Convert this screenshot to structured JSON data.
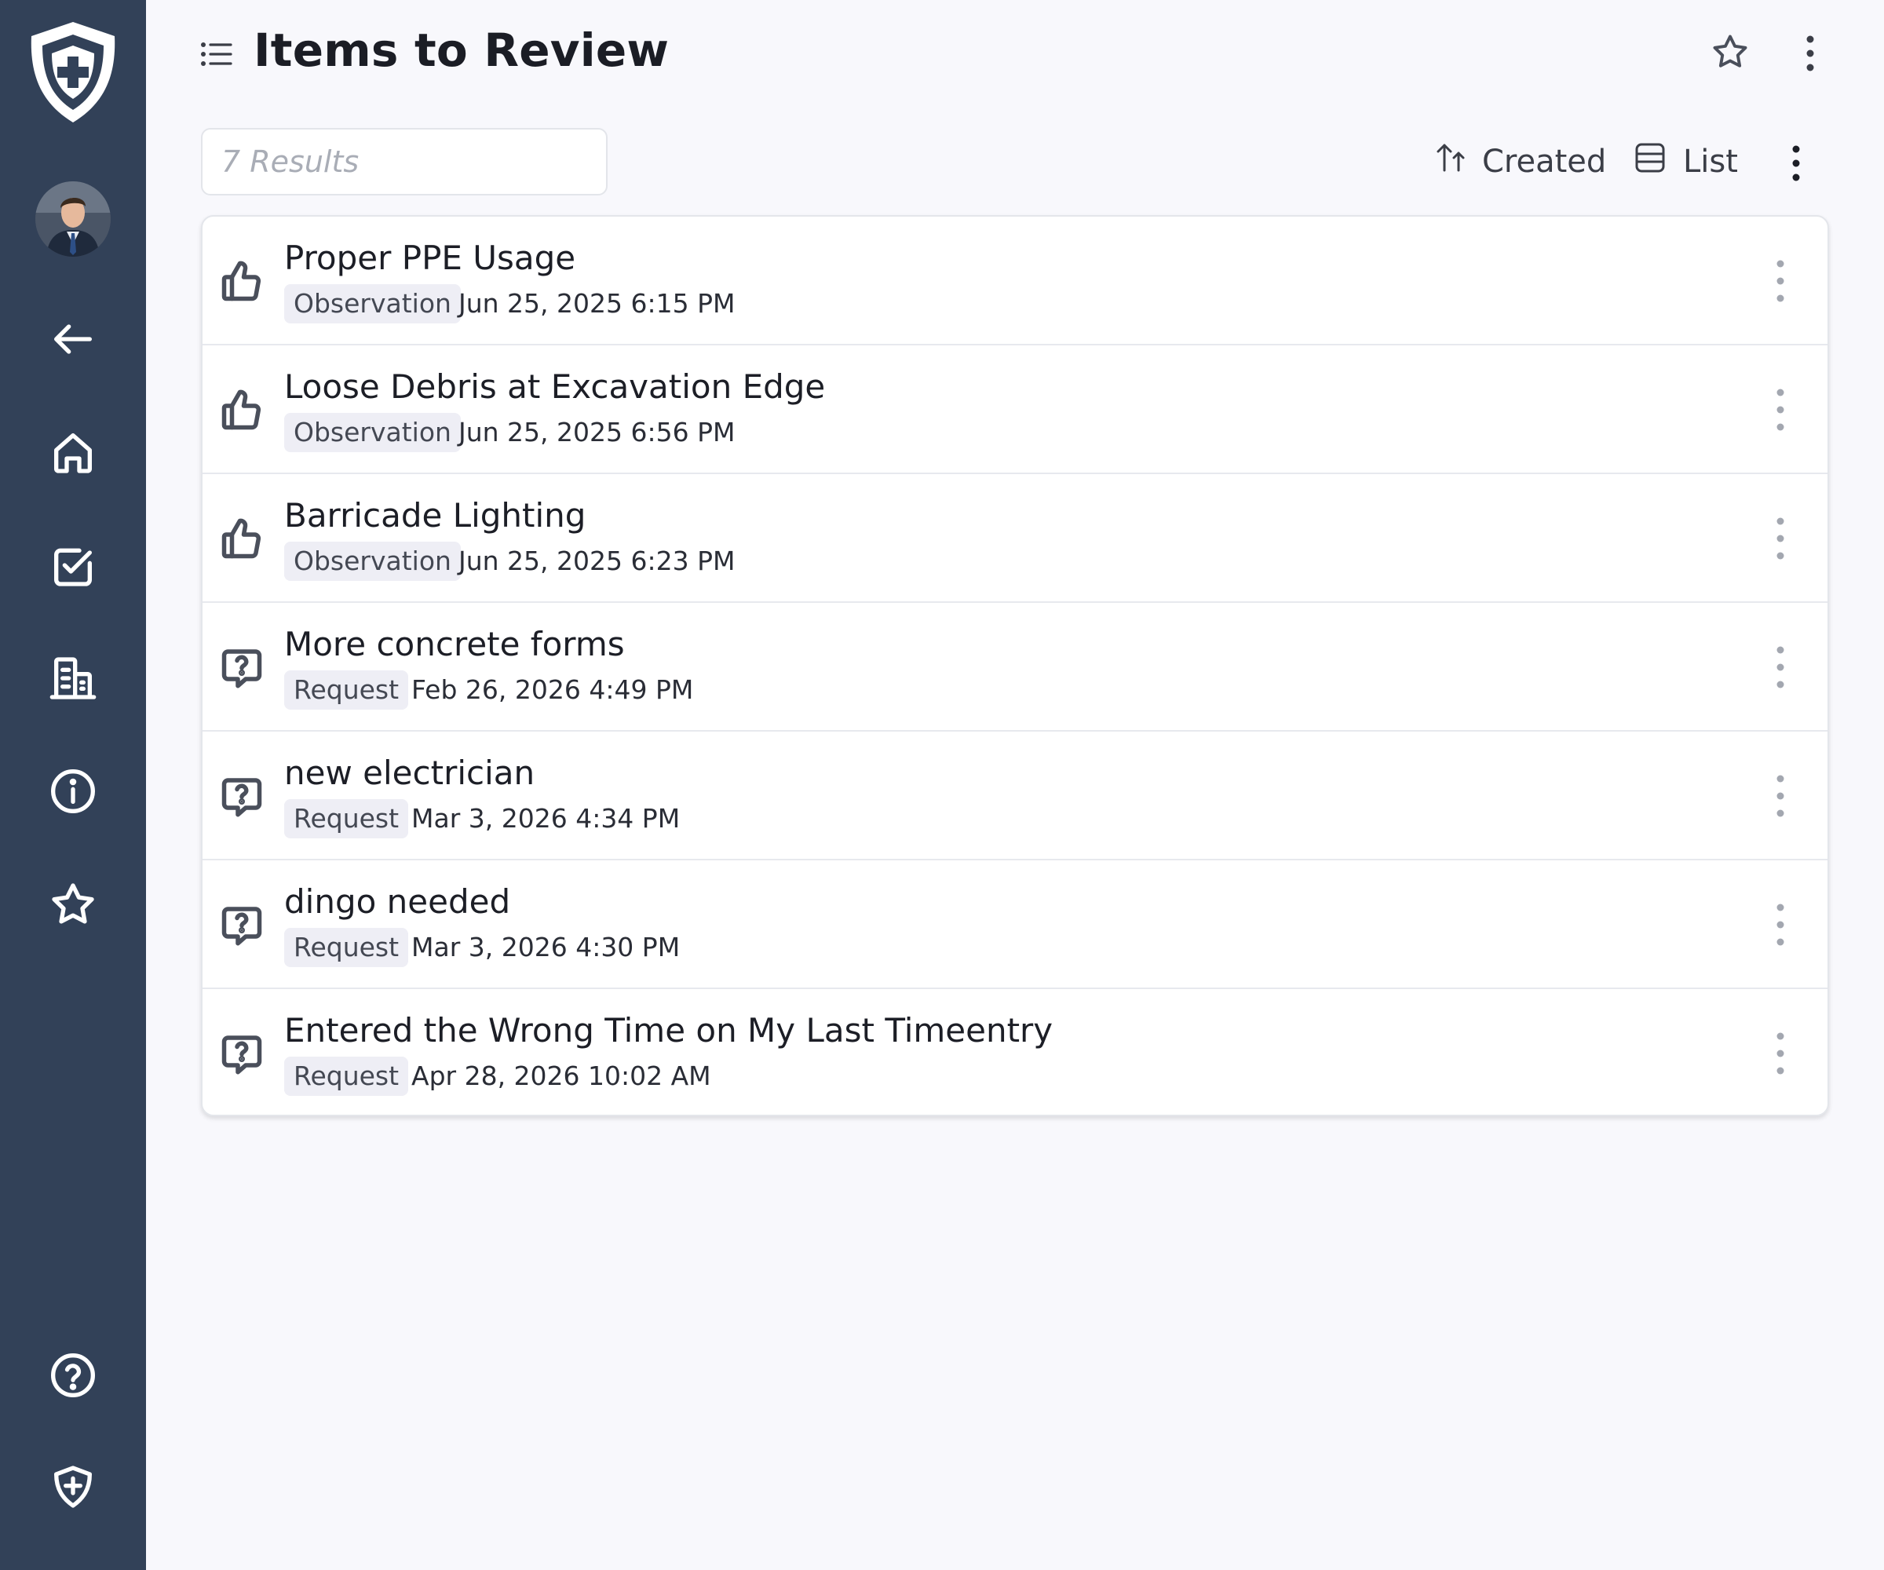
{
  "sidebar": {
    "logo": "shield-plus-logo",
    "avatar": "user-avatar",
    "items": [
      {
        "icon": "arrow-left-icon"
      },
      {
        "icon": "home-icon"
      },
      {
        "icon": "checkbox-icon"
      },
      {
        "icon": "building-icon"
      },
      {
        "icon": "info-icon"
      },
      {
        "icon": "star-icon"
      }
    ],
    "bottom_items": [
      {
        "icon": "help-circle-icon"
      },
      {
        "icon": "shield-icon"
      }
    ]
  },
  "header": {
    "title": "Items to Review"
  },
  "toolbar": {
    "search_placeholder": "7 Results",
    "sort_label": "Created",
    "view_label": "List"
  },
  "items": [
    {
      "icon": "thumbs-up-icon",
      "title": "Proper PPE Usage",
      "type": "Observation",
      "date": "Jun 25, 2025 6:15 PM"
    },
    {
      "icon": "thumbs-up-icon",
      "title": "Loose Debris at Excavation Edge",
      "type": "Observation",
      "date": "Jun 25, 2025 6:56 PM"
    },
    {
      "icon": "thumbs-up-icon",
      "title": "Barricade Lighting",
      "type": "Observation",
      "date": "Jun 25, 2025 6:23 PM"
    },
    {
      "icon": "question-bubble-icon",
      "title": "More concrete forms",
      "type": "Request",
      "date": "Feb 26, 2026 4:49 PM"
    },
    {
      "icon": "question-bubble-icon",
      "title": "new electrician",
      "type": "Request",
      "date": "Mar 3, 2026 4:34 PM"
    },
    {
      "icon": "question-bubble-icon",
      "title": "dingo needed",
      "type": "Request",
      "date": "Mar 3, 2026 4:30 PM"
    },
    {
      "icon": "question-bubble-icon",
      "title": "Entered the Wrong Time on My Last Timeentry",
      "type": "Request",
      "date": "Apr 28, 2026 10:02 AM"
    }
  ],
  "colors": {
    "sidebar_bg": "#324158",
    "page_bg": "#f8f8fc",
    "badge_bg": "#eeeef5",
    "text": "#1c1e26"
  }
}
